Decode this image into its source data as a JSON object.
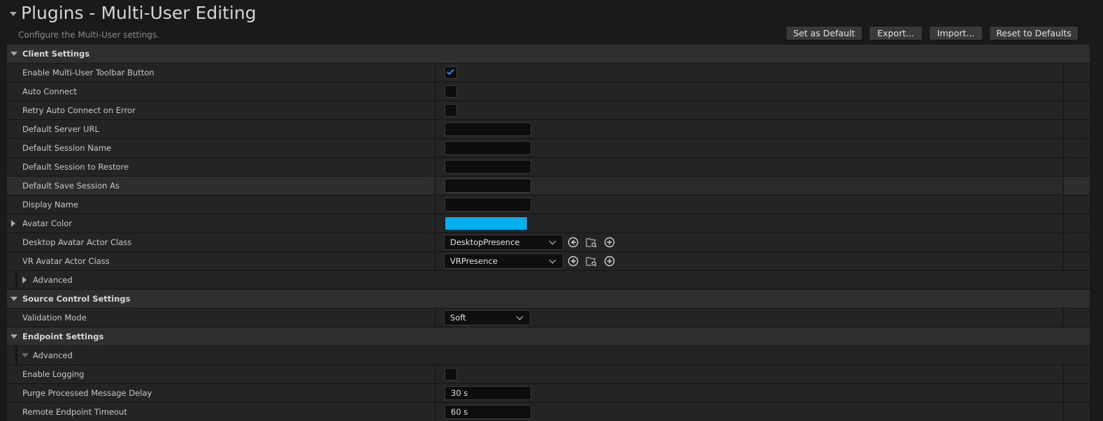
{
  "header": {
    "title": "Plugins - Multi-User Editing",
    "subtitle": "Configure the Multi-User settings.",
    "buttons": {
      "set_default": "Set as Default",
      "export": "Export...",
      "import": "Import...",
      "reset": "Reset to Defaults"
    }
  },
  "client_settings": {
    "label": "Client Settings",
    "enable_toolbar": {
      "label": "Enable Multi-User Toolbar Button",
      "checked": true
    },
    "auto_connect": {
      "label": "Auto Connect",
      "checked": false
    },
    "retry_auto_connect": {
      "label": "Retry Auto Connect on Error",
      "checked": false
    },
    "default_server_url": {
      "label": "Default Server URL",
      "value": ""
    },
    "default_session_name": {
      "label": "Default Session Name",
      "value": ""
    },
    "default_session_restore": {
      "label": "Default Session to Restore",
      "value": ""
    },
    "default_save_session": {
      "label": "Default Save Session As",
      "value": ""
    },
    "display_name": {
      "label": "Display Name",
      "value": ""
    },
    "avatar_color": {
      "label": "Avatar Color",
      "color": "#00aeef"
    },
    "desktop_avatar": {
      "label": "Desktop Avatar Actor Class",
      "value": "DesktopPresence"
    },
    "vr_avatar": {
      "label": "VR Avatar Actor Class",
      "value": "VRPresence"
    },
    "advanced": {
      "label": "Advanced"
    }
  },
  "source_control": {
    "label": "Source Control Settings",
    "validation_mode": {
      "label": "Validation Mode",
      "value": "Soft"
    }
  },
  "endpoint": {
    "label": "Endpoint Settings",
    "advanced": {
      "label": "Advanced"
    },
    "enable_logging": {
      "label": "Enable Logging",
      "checked": false
    },
    "purge_delay": {
      "label": "Purge Processed Message Delay",
      "value": "30 s"
    },
    "remote_timeout": {
      "label": "Remote Endpoint Timeout",
      "value": "60 s"
    }
  },
  "icons": {
    "browse": "arrow-left-circle-icon",
    "find": "folder-search-icon",
    "create": "plus-circle-icon"
  }
}
